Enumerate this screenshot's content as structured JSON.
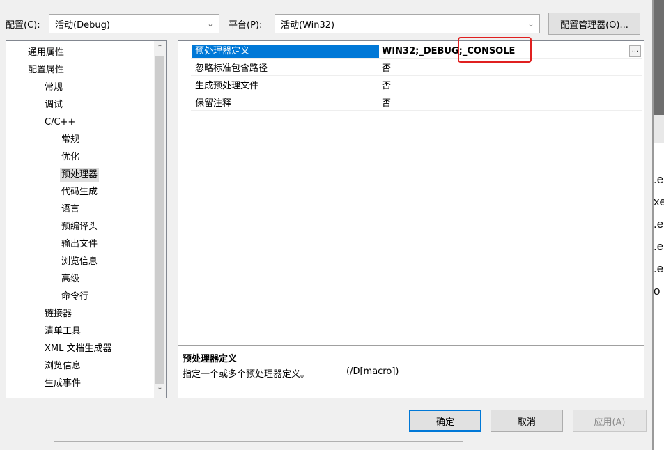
{
  "header": {
    "config_label": "配置(C):",
    "config_value": "活动(Debug)",
    "platform_label": "平台(P):",
    "platform_value": "活动(Win32)",
    "config_manager_button": "配置管理器(O)..."
  },
  "tree": {
    "items": [
      {
        "label": "通用属性",
        "level": 1
      },
      {
        "label": "配置属性",
        "level": 1
      },
      {
        "label": "常规",
        "level": 2
      },
      {
        "label": "调试",
        "level": 2
      },
      {
        "label": "C/C++",
        "level": 2
      },
      {
        "label": "常规",
        "level": 3
      },
      {
        "label": "优化",
        "level": 3
      },
      {
        "label": "预处理器",
        "level": 3,
        "selected": true
      },
      {
        "label": "代码生成",
        "level": 3
      },
      {
        "label": "语言",
        "level": 3
      },
      {
        "label": "预编译头",
        "level": 3
      },
      {
        "label": "输出文件",
        "level": 3
      },
      {
        "label": "浏览信息",
        "level": 3
      },
      {
        "label": "高级",
        "level": 3
      },
      {
        "label": "命令行",
        "level": 3
      },
      {
        "label": "链接器",
        "level": 2
      },
      {
        "label": "清单工具",
        "level": 2
      },
      {
        "label": "XML 文档生成器",
        "level": 2
      },
      {
        "label": "浏览信息",
        "level": 2
      },
      {
        "label": "生成事件",
        "level": 2
      }
    ]
  },
  "properties": [
    {
      "name": "预处理器定义",
      "value": "WIN32;_DEBUG;_CONSOLE",
      "selected": true
    },
    {
      "name": "忽略标准包含路径",
      "value": "否"
    },
    {
      "name": "生成预处理文件",
      "value": "否"
    },
    {
      "name": "保留注释",
      "value": "否"
    }
  ],
  "ellipsis_label": "...",
  "description": {
    "title": "预处理器定义",
    "text": "指定一个或多个预处理器定义。",
    "switch": "(/D[macro])"
  },
  "buttons": {
    "ok": "确定",
    "cancel": "取消",
    "apply": "应用(A)"
  },
  "background_fragments": [
    ".e",
    "xe",
    ".e",
    ".e",
    ".e",
    "o"
  ],
  "colors": {
    "selection": "#0078d7",
    "highlight_box": "#e02020",
    "tree_selected": "#e0e0e0"
  }
}
